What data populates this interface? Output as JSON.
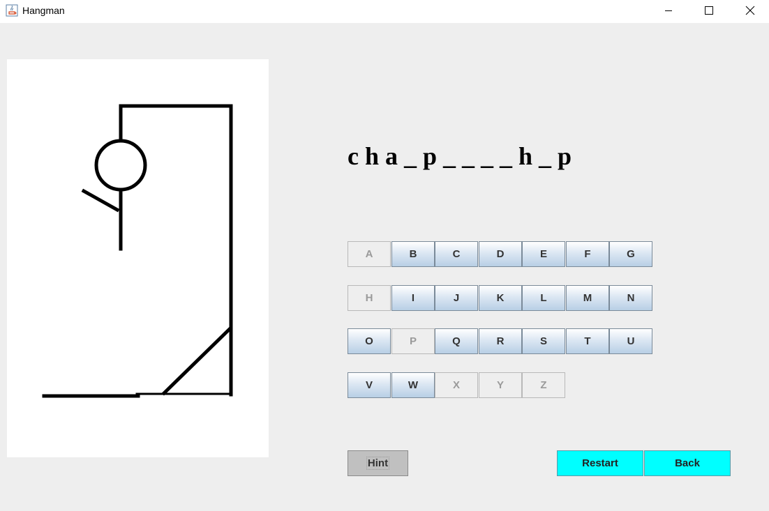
{
  "window": {
    "title": "Hangman",
    "icon": "java-icon"
  },
  "word_display": "c h a _ p _ _ _ _ h _ p",
  "keyboard": {
    "rows": [
      [
        {
          "label": "A",
          "used": true
        },
        {
          "label": "B",
          "used": false
        },
        {
          "label": "C",
          "used": false
        },
        {
          "label": "D",
          "used": false
        },
        {
          "label": "E",
          "used": false
        },
        {
          "label": "F",
          "used": false
        },
        {
          "label": "G",
          "used": false
        }
      ],
      [
        {
          "label": "H",
          "used": true
        },
        {
          "label": "I",
          "used": false
        },
        {
          "label": "J",
          "used": false
        },
        {
          "label": "K",
          "used": false
        },
        {
          "label": "L",
          "used": false
        },
        {
          "label": "M",
          "used": false
        },
        {
          "label": "N",
          "used": false
        }
      ],
      [
        {
          "label": "O",
          "used": false
        },
        {
          "label": "P",
          "used": true
        },
        {
          "label": "Q",
          "used": false
        },
        {
          "label": "R",
          "used": false
        },
        {
          "label": "S",
          "used": false
        },
        {
          "label": "T",
          "used": false
        },
        {
          "label": "U",
          "used": false
        }
      ],
      [
        {
          "label": "V",
          "used": false
        },
        {
          "label": "W",
          "used": false
        },
        {
          "label": "X",
          "used": true
        },
        {
          "label": "Y",
          "used": true
        },
        {
          "label": "Z",
          "used": true
        }
      ]
    ]
  },
  "buttons": {
    "hint": "Hint",
    "restart": "Restart",
    "back": "Back"
  },
  "colors": {
    "restart_bg": "#00ffff",
    "back_bg": "#00ffff",
    "hint_bg": "#c0c0c0"
  }
}
